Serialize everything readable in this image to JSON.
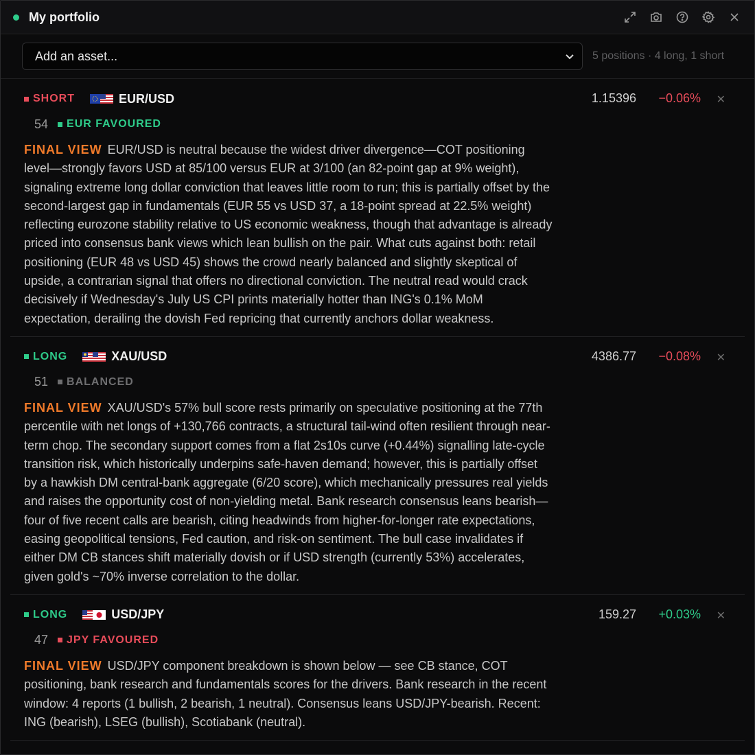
{
  "window": {
    "title": "My portfolio",
    "status_color": "#2ecc8a"
  },
  "toolbar_icons": [
    "expand-icon",
    "camera-icon",
    "help-icon",
    "gear-icon",
    "close-icon"
  ],
  "asset_select": {
    "placeholder": "Add an asset...",
    "summary": "5 positions · 4 long, 1 short"
  },
  "colors": {
    "short": "#e84c5a",
    "long": "#2ecc8a",
    "final_view": "#f07a2a",
    "neutral": "#6e6e70"
  },
  "positions": [
    {
      "direction": "SHORT",
      "pair": "EUR/USD",
      "flag": "eu-us-flag-icon",
      "price": "1.15396",
      "change": "−0.06%",
      "score": "54",
      "bias": "EUR FAVOURED",
      "final_view_label": "FINAL VIEW",
      "text": "EUR/USD is neutral because the widest driver divergence—COT positioning level—strongly favors USD at 85/100 versus EUR at 3/100 (an 82-point gap at 9% weight), signaling extreme long dollar conviction that leaves little room to run; this is partially offset by the second-largest gap in fundamentals (EUR 55 vs USD 37, a 18-point spread at 22.5% weight) reflecting eurozone stability relative to US economic weakness, though that advantage is already priced into consensus bank views which lean bullish on the pair. What cuts against both: retail positioning (EUR 48 vs USD 45) shows the crowd nearly balanced and slightly skeptical of upside, a contrarian signal that offers no directional conviction. The neutral read would crack decisively if Wednesday's July US CPI prints materially hotter than ING's 0.1% MoM expectation, derailing the dovish Fed repricing that currently anchors dollar weakness."
    },
    {
      "direction": "LONG",
      "pair": "XAU/USD",
      "flag": "my-us-flag-icon",
      "price": "4386.77",
      "change": "−0.08%",
      "score": "51",
      "bias": "BALANCED",
      "final_view_label": "FINAL VIEW",
      "text": "XAU/USD's 57% bull score rests primarily on speculative positioning at the 77th percentile with net longs of +130,766 contracts, a structural tail-wind often resilient through near-term chop. The secondary support comes from a flat 2s10s curve (+0.44%) signalling late-cycle transition risk, which historically underpins safe-haven demand; however, this is partially offset by a hawkish DM central-bank aggregate (6/20 score), which mechanically pressures real yields and raises the opportunity cost of non-yielding metal. Bank research consensus leans bearish—four of five recent calls are bearish, citing headwinds from higher-for-longer rate expectations, easing geopolitical tensions, Fed caution, and risk-on sentiment. The bull case invalidates if either DM CB stances shift materially dovish or if USD strength (currently 53%) accelerates, given gold's ~70% inverse correlation to the dollar."
    },
    {
      "direction": "LONG",
      "pair": "USD/JPY",
      "flag": "us-jp-flag-icon",
      "price": "159.27",
      "change": "+0.03%",
      "score": "47",
      "bias": "JPY FAVOURED",
      "final_view_label": "FINAL VIEW",
      "text": "USD/JPY component breakdown is shown below — see CB stance, COT positioning, bank research and fundamentals scores for the drivers. Bank research in the recent window: 4 reports (1 bullish, 2 bearish, 1 neutral). Consensus leans USD/JPY-bearish. Recent: ING (bearish), LSEG (bullish), Scotiabank (neutral)."
    }
  ]
}
